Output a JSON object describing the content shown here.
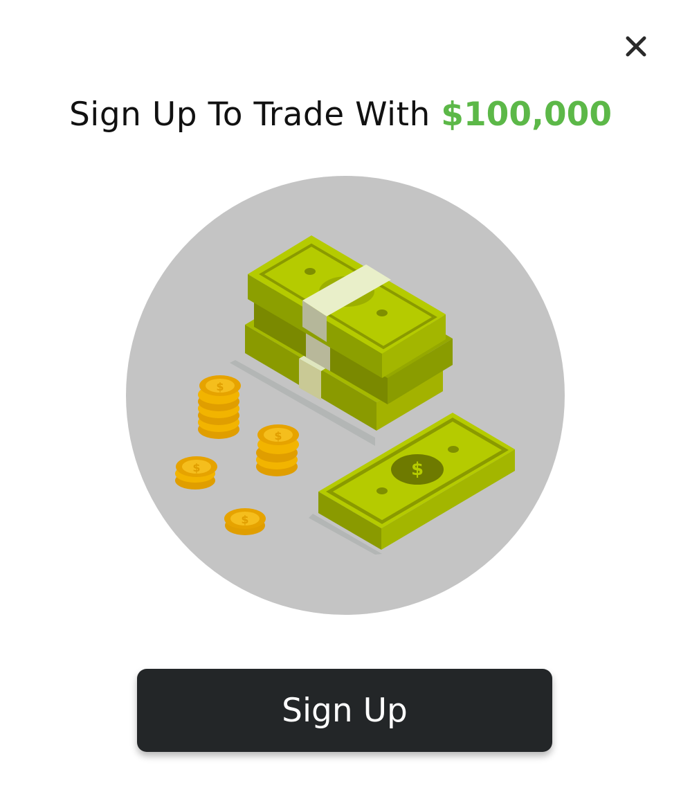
{
  "modal": {
    "title_text": "Sign Up To Trade With ",
    "title_amount": "$100,000",
    "amount_color": "#5cb848",
    "close_icon": "close-icon",
    "illustration": {
      "description_icon": "money-stack-with-coins-icon",
      "circle_color": "#c4c4c4",
      "bill_color": "#b5cb00",
      "coin_color": "#f5b800"
    },
    "cta_label": "Sign Up",
    "cta_color": "#232628"
  }
}
